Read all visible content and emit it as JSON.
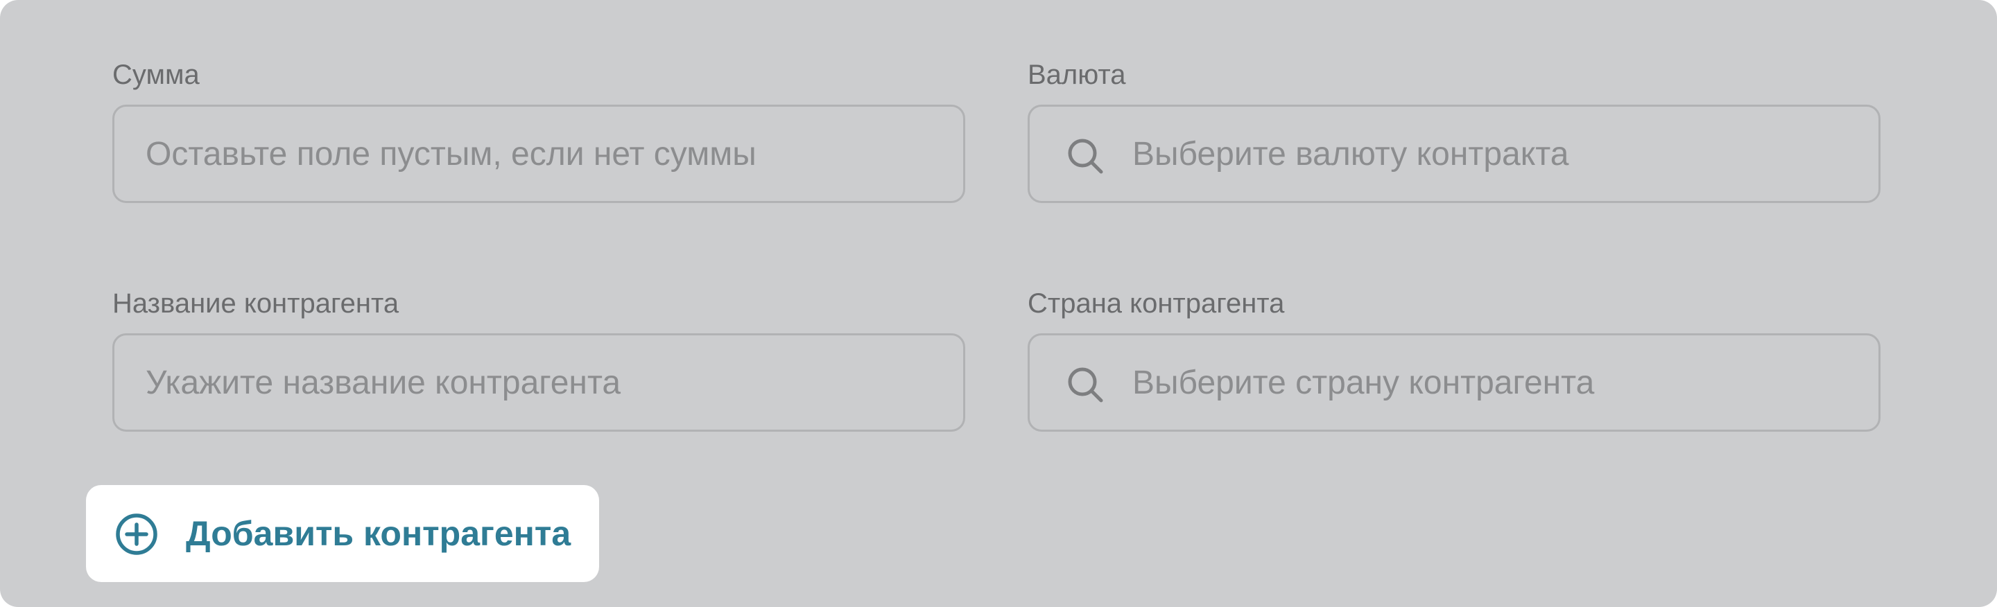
{
  "form": {
    "amount": {
      "label": "Сумма",
      "placeholder": "Оставьте поле пустым, если нет суммы",
      "value": ""
    },
    "currency": {
      "label": "Валюта",
      "placeholder": "Выберите валюту контракта",
      "value": "",
      "icon": "search-icon"
    },
    "counterparty_name": {
      "label": "Название контрагента",
      "placeholder": "Укажите название контрагента",
      "value": ""
    },
    "counterparty_country": {
      "label": "Страна контрагента",
      "placeholder": "Выберите страну контрагента",
      "value": "",
      "icon": "search-icon"
    }
  },
  "add_counterparty": {
    "label": "Добавить контрагента",
    "icon": "plus-circle-icon"
  },
  "colors": {
    "panel_background": "#cccdcf",
    "label_text": "#6a6b6d",
    "placeholder_text": "#8c8d8f",
    "field_border": "#b1b2b4",
    "accent": "#2f7c95",
    "button_background": "#ffffff"
  }
}
